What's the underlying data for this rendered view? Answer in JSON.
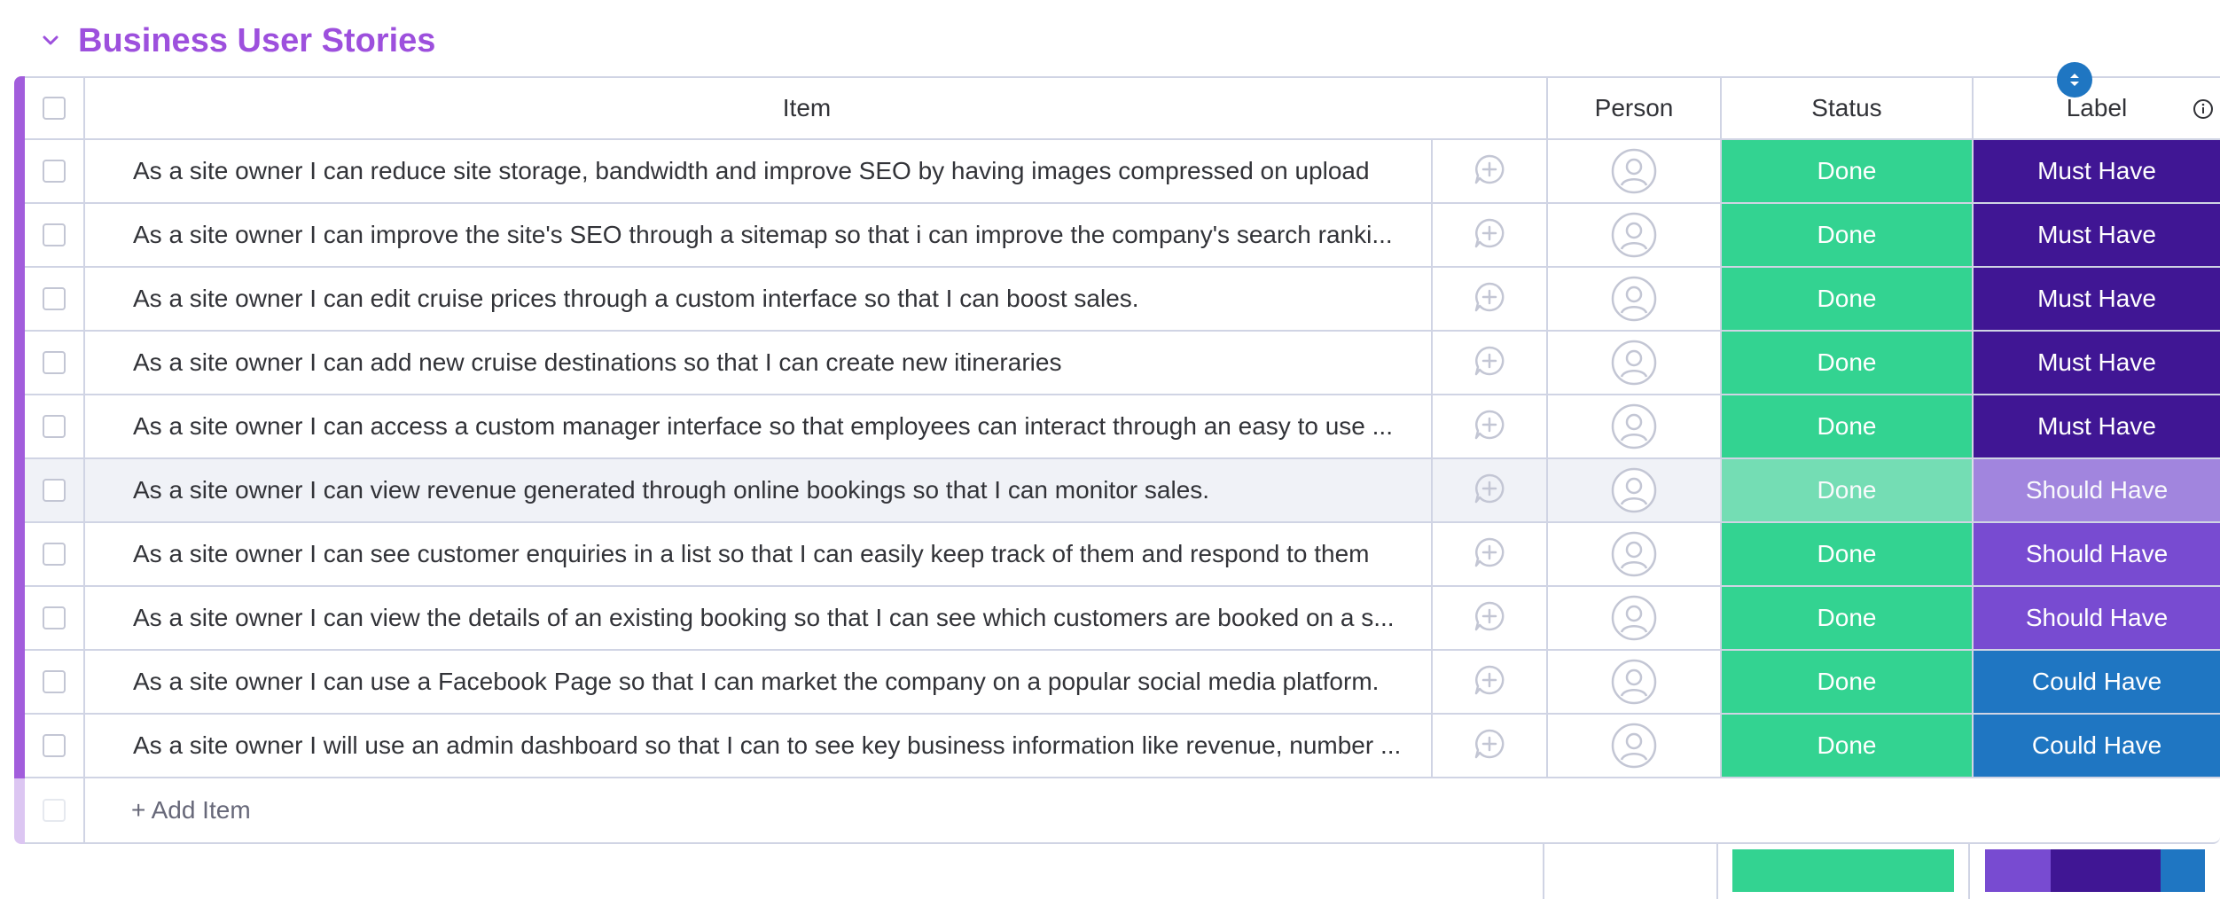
{
  "group": {
    "title": "Business User Stories",
    "color": "#9d50dd",
    "chevron_icon": "chevron-down-icon"
  },
  "columns": {
    "item": "Item",
    "person": "Person",
    "status": "Status",
    "label": "Label"
  },
  "rows": [
    {
      "text": "As a site owner I can reduce site storage, bandwidth and improve SEO by having images compressed on upload",
      "status": "Done",
      "label": "Must Have"
    },
    {
      "text": "As a site owner I can improve the site's SEO through a sitemap so that i can improve the company's search ranki...",
      "status": "Done",
      "label": "Must Have"
    },
    {
      "text": "As a site owner I can edit cruise prices through a custom interface so that I can boost sales.",
      "status": "Done",
      "label": "Must Have"
    },
    {
      "text": "As a site owner I can add new cruise destinations so that I can create new itineraries",
      "status": "Done",
      "label": "Must Have"
    },
    {
      "text": "As a site owner I can access a custom manager interface so that employees can interact through an easy to use ...",
      "status": "Done",
      "label": "Must Have"
    },
    {
      "text": "As a site owner I can view revenue generated through online bookings so that I can monitor sales.",
      "status": "Done",
      "label": "Should Have"
    },
    {
      "text": "As a site owner I can see customer enquiries in a list so that I can easily keep track of them and respond to them",
      "status": "Done",
      "label": "Should Have"
    },
    {
      "text": "As a site owner I can view the details of an existing booking so that I can see which customers are booked on a s...",
      "status": "Done",
      "label": "Should Have"
    },
    {
      "text": "As a site owner I can use a Facebook Page so that I can market the company on a popular social media platform.",
      "status": "Done",
      "label": "Could Have"
    },
    {
      "text": "As a site owner I will use an admin dashboard so that I can to see key business information like revenue, number ...",
      "status": "Done",
      "label": "Could Have"
    }
  ],
  "hovered_row": 6,
  "add_item": "+ Add Item",
  "colors": {
    "done": "#33d391",
    "must_have": "#401694",
    "should_have": "#784bd1",
    "could_have": "#1f76c2",
    "group_bar": "#a25ddc"
  },
  "summary": {
    "status_fractions": {
      "Done": 1.0
    },
    "label_fractions": [
      {
        "label": "Should Have",
        "fraction": 0.3
      },
      {
        "label": "Must Have",
        "fraction": 0.5
      },
      {
        "label": "Could Have",
        "fraction": 0.2
      }
    ]
  }
}
